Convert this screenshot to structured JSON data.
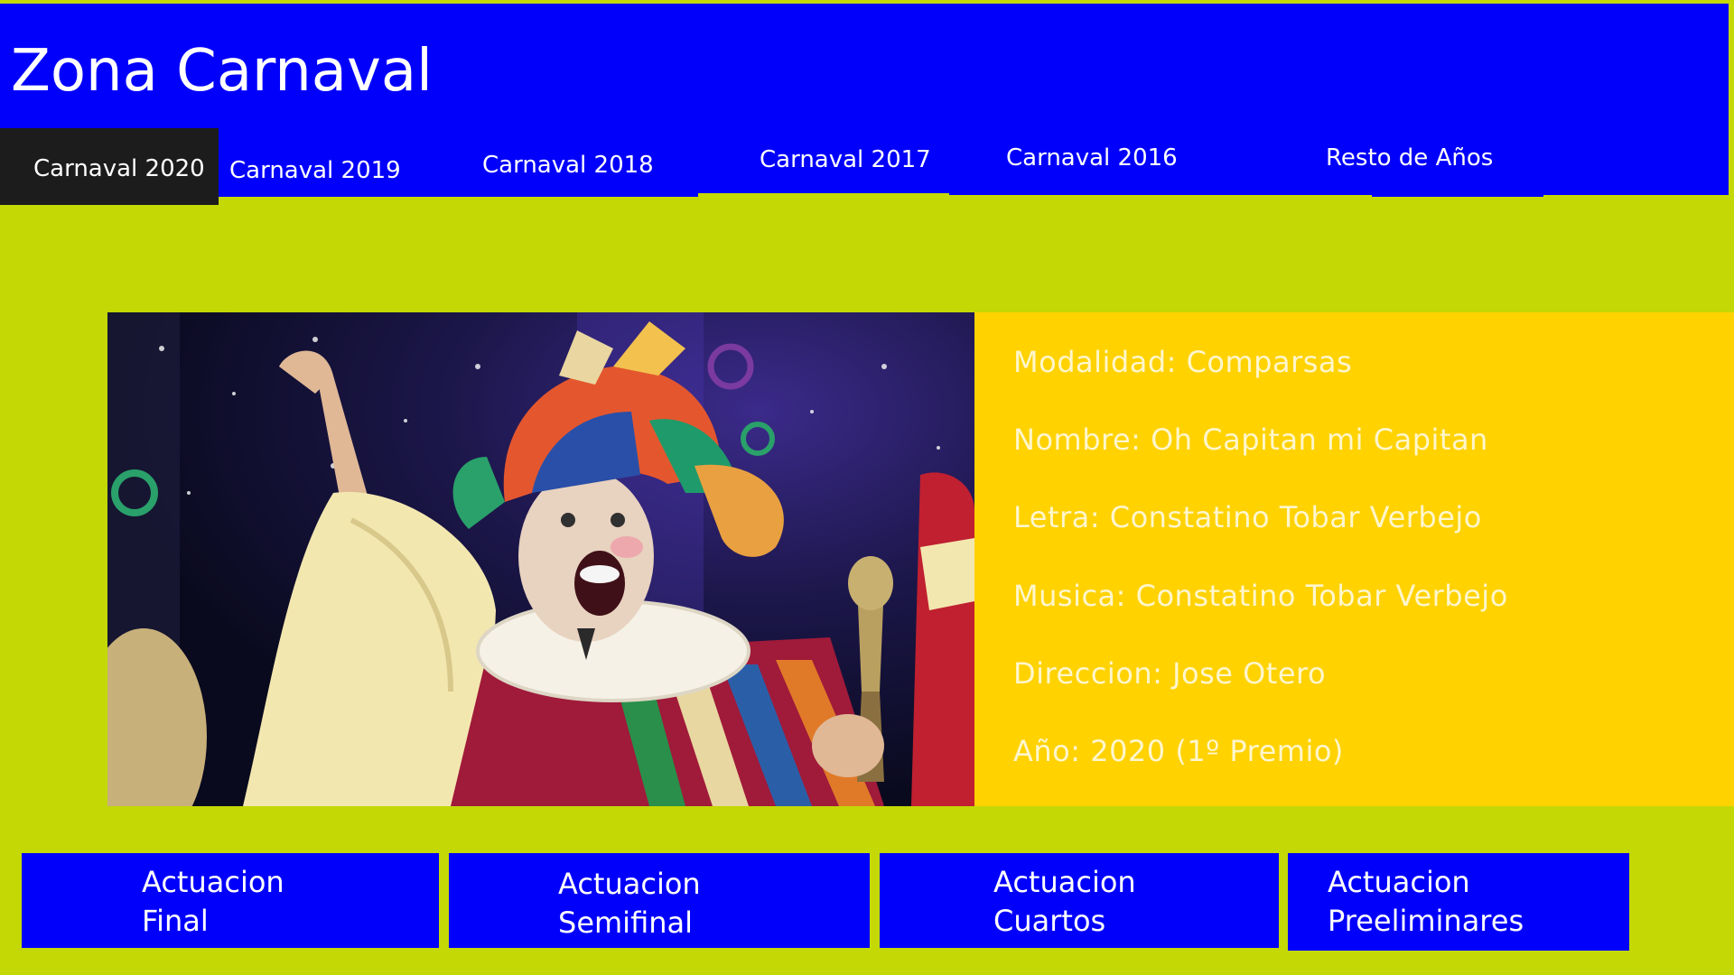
{
  "header": {
    "title": "Zona Carnaval"
  },
  "tabs": [
    {
      "label": "Carnaval 2020",
      "active": true
    },
    {
      "label": "Carnaval 2019"
    },
    {
      "label": "Carnaval 2018"
    },
    {
      "label": "Carnaval 2017"
    },
    {
      "label": "Carnaval 2016"
    },
    {
      "label": "Resto de Años"
    }
  ],
  "details": {
    "modalidad": "Modalidad: Comparsas",
    "nombre": "Nombre: Oh Capitan mi Capitan",
    "letra": "Letra: Constatino Tobar Verbejo",
    "musica": "Musica: Constatino Tobar Verbejo",
    "direccion": "Direccion: Jose Otero",
    "anio": "Año: 2020 (1º Premio)"
  },
  "buttons": [
    {
      "line1": "Actuacion",
      "line2": "Final"
    },
    {
      "line1": "Actuacion",
      "line2": "Semifinal"
    },
    {
      "line1": "Actuacion",
      "line2": "Cuartos"
    },
    {
      "line1": "Actuacion",
      "line2": "Preeliminares"
    }
  ],
  "colors": {
    "page_bg": "#c3d804",
    "header_bg": "#0000fb",
    "active_tab_bg": "#1c1c1c",
    "info_bg": "#ffd200",
    "button_bg": "#0000fb"
  }
}
